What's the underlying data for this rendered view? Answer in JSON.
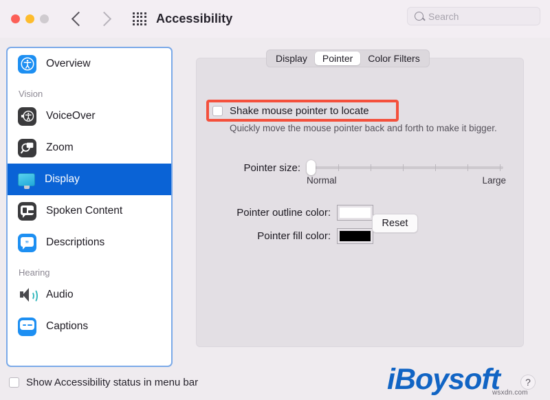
{
  "window": {
    "title": "Accessibility",
    "traffic_lights": [
      "close",
      "minimize",
      "zoom"
    ],
    "back_icon": "chevron-left-icon",
    "forward_icon": "chevron-right-icon",
    "grid_icon": "grid-apps-icon"
  },
  "search": {
    "placeholder": "Search",
    "value": "",
    "icon": "search-icon"
  },
  "sidebar": {
    "items": [
      {
        "label": "Overview",
        "icon": "accessibility-icon",
        "selected": false
      },
      {
        "label": "VoiceOver",
        "icon": "voiceover-icon",
        "selected": false
      },
      {
        "label": "Zoom",
        "icon": "zoom-icon",
        "selected": false
      },
      {
        "label": "Display",
        "icon": "display-monitor-icon",
        "selected": true
      },
      {
        "label": "Spoken Content",
        "icon": "speech-bubble-icon",
        "selected": false
      },
      {
        "label": "Descriptions",
        "icon": "descriptions-icon",
        "selected": false
      },
      {
        "label": "Audio",
        "icon": "speaker-icon",
        "selected": false
      },
      {
        "label": "Captions",
        "icon": "captions-icon",
        "selected": false
      }
    ],
    "groups": {
      "vision": "Vision",
      "hearing": "Hearing"
    }
  },
  "bottom": {
    "show_status_label": "Show Accessibility status in menu bar",
    "show_status_checked": false
  },
  "main": {
    "tabs": [
      {
        "label": "Display",
        "active": false
      },
      {
        "label": "Pointer",
        "active": true
      },
      {
        "label": "Color Filters",
        "active": false
      }
    ],
    "shake": {
      "label": "Shake mouse pointer to locate",
      "checked": false,
      "help": "Quickly move the mouse pointer back and forth to make it bigger."
    },
    "pointer_size": {
      "label": "Pointer size:",
      "min_label": "Normal",
      "max_label": "Large",
      "value": 0,
      "ticks": 6
    },
    "outline_color": {
      "label": "Pointer outline color:",
      "value": "#ffffff"
    },
    "fill_color": {
      "label": "Pointer fill color:",
      "value": "#000000"
    },
    "reset_label": "Reset"
  },
  "annotation": {
    "color": "#f4503c",
    "target": "shake-mouse-pointer-checkbox"
  },
  "watermark": {
    "brand": "iBoysoft",
    "site": "wsxdn.com",
    "help_label": "?"
  }
}
